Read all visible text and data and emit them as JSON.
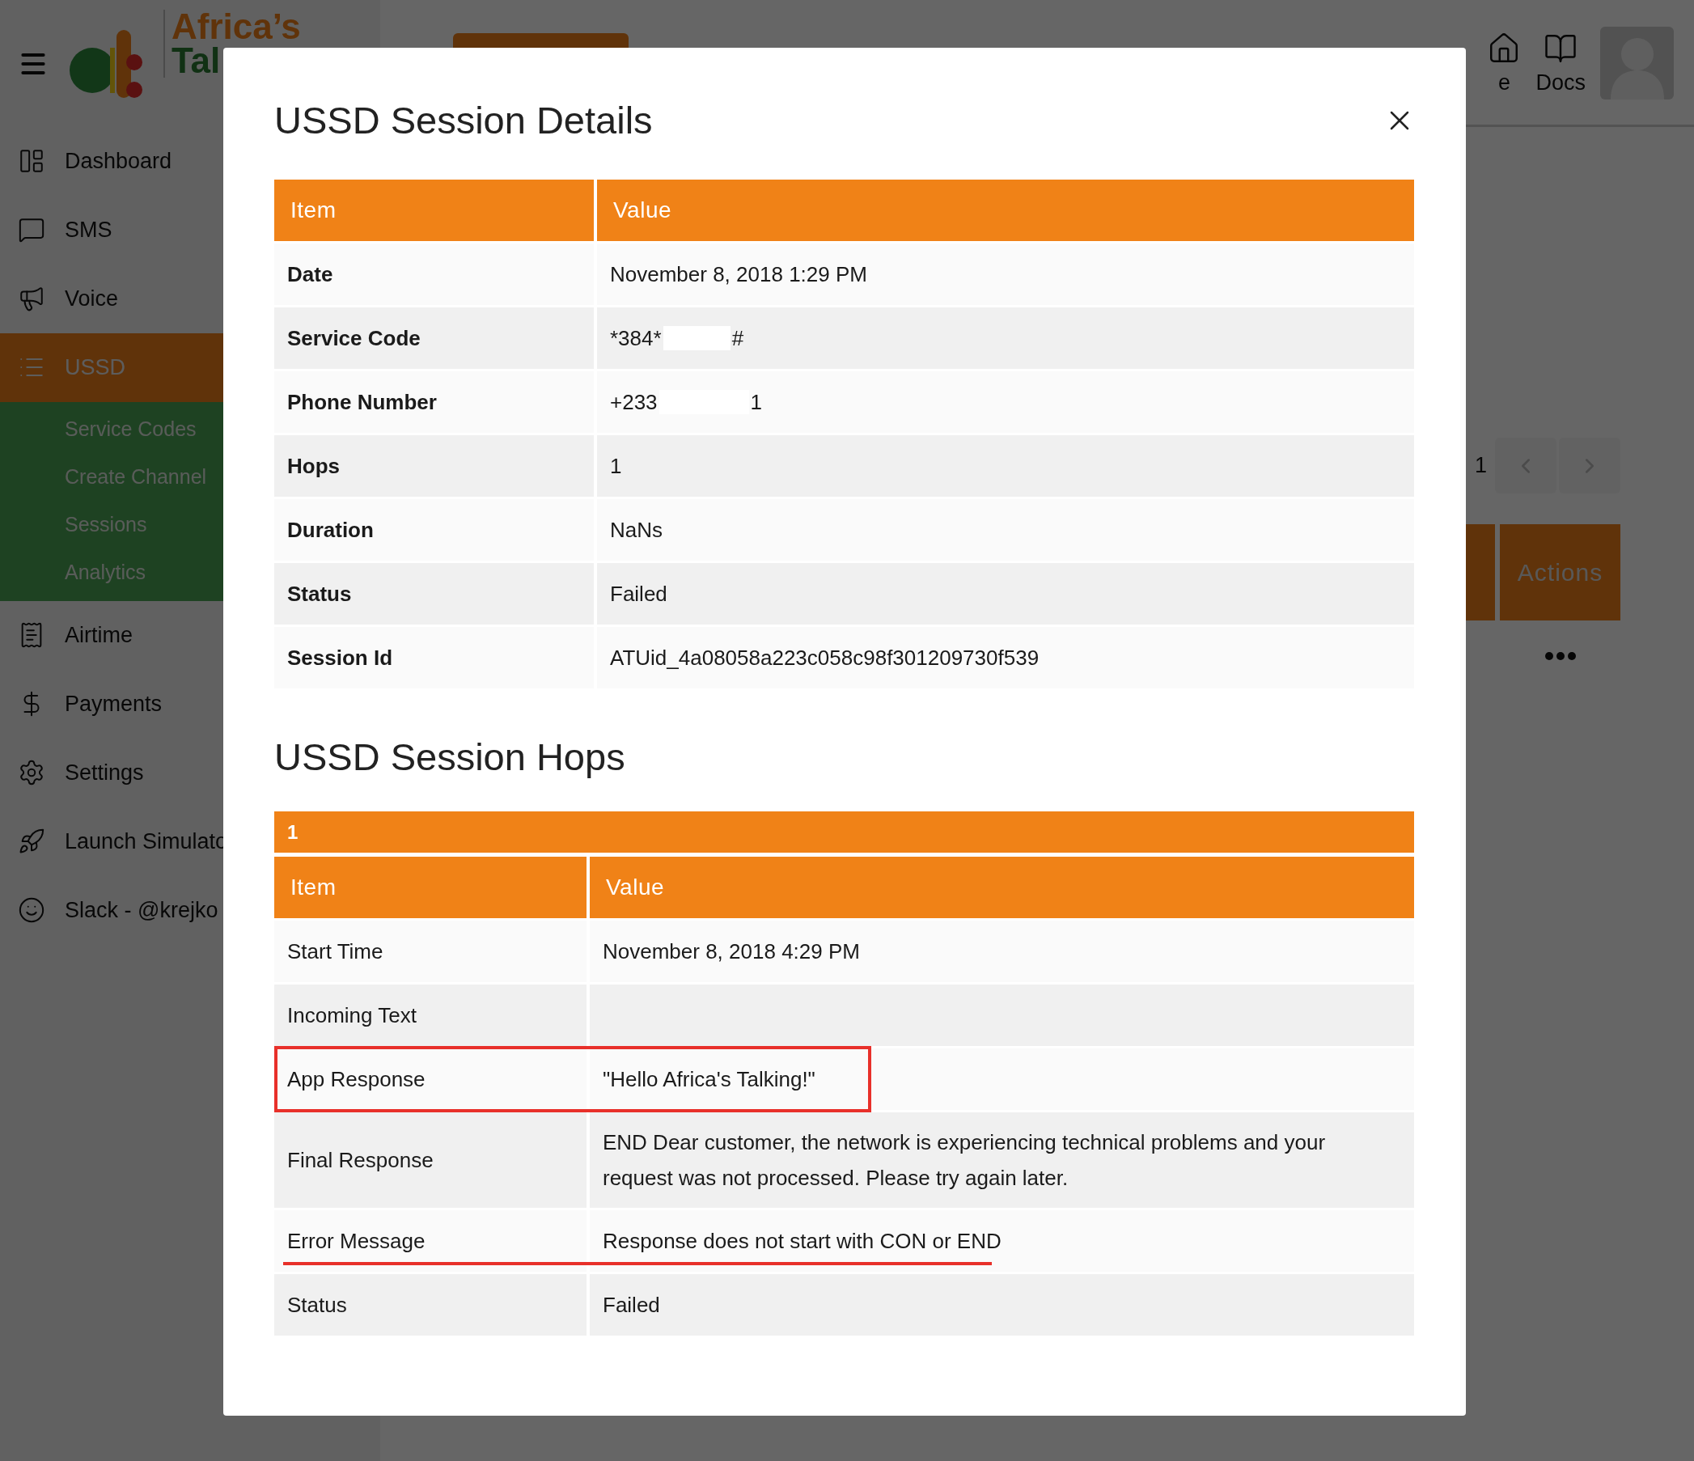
{
  "header": {
    "logo_text": [
      "Africa’s",
      "Tal"
    ],
    "nav": [
      {
        "label": "e"
      },
      {
        "label": "Docs"
      }
    ]
  },
  "sidebar": {
    "items": [
      {
        "label": "Dashboard",
        "selected": false
      },
      {
        "label": "SMS",
        "selected": false
      },
      {
        "label": "Voice",
        "selected": false
      },
      {
        "label": "USSD",
        "selected": true,
        "expanded": true,
        "children": [
          {
            "label": "Service Codes",
            "selected": false
          },
          {
            "label": "Create Channel",
            "selected": false
          },
          {
            "label": "Sessions",
            "selected": false
          },
          {
            "label": "Analytics",
            "selected": false
          }
        ]
      },
      {
        "label": "Airtime",
        "selected": false
      },
      {
        "label": "Payments",
        "selected": false
      },
      {
        "label": "Settings",
        "selected": false
      },
      {
        "label": "Launch Simulato",
        "selected": false
      },
      {
        "label": "Slack - @krejko",
        "selected": false
      }
    ]
  },
  "background": {
    "pager_label": "1",
    "table_columns": [
      "Actions"
    ]
  },
  "modal": {
    "title": "USSD Session Details",
    "details_table": {
      "columns": [
        "Item",
        "Value"
      ],
      "rows": [
        {
          "item": "Date",
          "value": "November 8, 2018 1:29 PM"
        },
        {
          "item": "Service Code",
          "value": "*384*",
          "redacted": true,
          "value_end": "#"
        },
        {
          "item": "Phone Number",
          "value": "+233",
          "redacted": true,
          "value_end": "1"
        },
        {
          "item": "Hops",
          "value": "1"
        },
        {
          "item": "Duration",
          "value": "NaNs"
        },
        {
          "item": "Status",
          "value": "Failed"
        },
        {
          "item": "Session Id",
          "value": "ATUid_4a08058a223c058c98f301209730f539"
        }
      ]
    },
    "hops_title": "USSD Session Hops",
    "hops": [
      {
        "label": "1",
        "columns": [
          "Item",
          "Value"
        ],
        "rows": [
          {
            "item": "Start Time",
            "value": "November 8, 2018 4:29 PM",
            "boxed": false,
            "underlined": false
          },
          {
            "item": "Incoming Text",
            "value": "",
            "boxed": false,
            "underlined": false
          },
          {
            "item": "App Response",
            "value": "\"Hello Africa's Talking!\"",
            "boxed": true,
            "underlined": false
          },
          {
            "item": "Final Response",
            "value": "END Dear customer, the network is experiencing technical problems and your request was not processed. Please try again later.",
            "boxed": false,
            "underlined": false
          },
          {
            "item": "Error Message",
            "value": "Response does not start with CON or END",
            "boxed": false,
            "underlined": true
          },
          {
            "item": "Status",
            "value": "Failed",
            "boxed": false,
            "underlined": false
          }
        ]
      }
    ]
  }
}
